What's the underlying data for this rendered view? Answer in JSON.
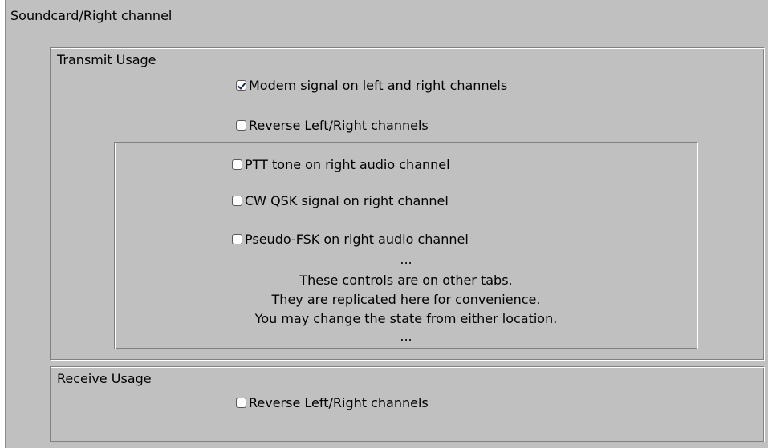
{
  "panel": {
    "title": "Soundcard/Right channel"
  },
  "transmit": {
    "label": "Transmit Usage",
    "options": [
      {
        "label": "Modem signal on left and right channels",
        "checked": true
      },
      {
        "label": "Reverse Left/Right channels",
        "checked": false
      }
    ],
    "replicated": {
      "options": [
        {
          "label": "PTT tone on right audio channel",
          "checked": false
        },
        {
          "label": "CW QSK signal on right channel",
          "checked": false
        },
        {
          "label": "Pseudo-FSK on right audio channel",
          "checked": false
        }
      ],
      "note": {
        "ellipsis_top": "...",
        "line1": "These controls are on other tabs.",
        "line2": "They are replicated here for convenience.",
        "line3": "You may change the state from either location.",
        "ellipsis_bottom": "..."
      }
    }
  },
  "receive": {
    "label": "Receive Usage",
    "options": [
      {
        "label": "Reverse Left/Right channels",
        "checked": false
      }
    ]
  }
}
